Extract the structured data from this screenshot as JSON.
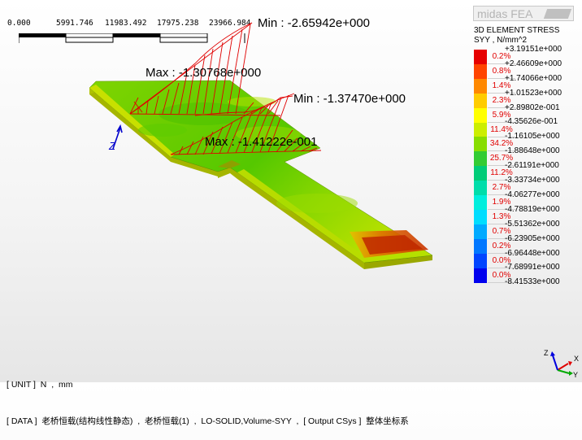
{
  "scale": {
    "labels": [
      "0.000",
      "5991.746",
      "11983.492",
      "17975.238",
      "23966.984"
    ]
  },
  "logo": {
    "text": "midas FEA"
  },
  "legend": {
    "title": "3D ELEMENT STRESS",
    "component": "SYY , N/mm^2",
    "top_value": "+3.19151e+000",
    "rows": [
      {
        "color": "#e60000",
        "pct": "0.2%",
        "value": "+2.46609e+000"
      },
      {
        "color": "#ff4400",
        "pct": "0.8%",
        "value": "+1.74066e+000"
      },
      {
        "color": "#ff8800",
        "pct": "1.4%",
        "value": "+1.01523e+000"
      },
      {
        "color": "#ffcc00",
        "pct": "2.3%",
        "value": "+2.89802e-001"
      },
      {
        "color": "#ffff00",
        "pct": "5.9%",
        "value": "-4.35626e-001"
      },
      {
        "color": "#ccee00",
        "pct": "11.4%",
        "value": "-1.16105e+000"
      },
      {
        "color": "#88dd00",
        "pct": "34.2%",
        "value": "-1.88648e+000"
      },
      {
        "color": "#33cc33",
        "pct": "25.7%",
        "value": "-2.61191e+000"
      },
      {
        "color": "#00cc77",
        "pct": "11.2%",
        "value": "-3.33734e+000"
      },
      {
        "color": "#00ddaa",
        "pct": "2.7%",
        "value": "-4.06277e+000"
      },
      {
        "color": "#00eedd",
        "pct": "1.9%",
        "value": "-4.78819e+000"
      },
      {
        "color": "#00ddff",
        "pct": "1.3%",
        "value": "-5.51362e+000"
      },
      {
        "color": "#00aaff",
        "pct": "0.7%",
        "value": "-6.23905e+000"
      },
      {
        "color": "#0077ff",
        "pct": "0.2%",
        "value": "-6.96448e+000"
      },
      {
        "color": "#0044ff",
        "pct": "0.0%",
        "value": "-7.68991e+000"
      },
      {
        "color": "#0000ee",
        "pct": "0.0%",
        "value": "-8.41533e+000"
      }
    ]
  },
  "annotations": {
    "min1": "Min : -2.65942e+000",
    "max1": "Max : -1.30768e+000",
    "min2": "Min : -1.37470e+000",
    "max2": "Max : -1.41222e-001",
    "axis_label": "Z"
  },
  "info": {
    "unit_line": "[ UNIT ]  N  ,  mm",
    "data_line": "[ DATA ]  老桥恒载(结构线性静态)  ,  老桥恒载(1)  ,  LO-SOLID,Volume-SYY  ,  [ Output CSys ]  整体坐标系"
  },
  "triad": {
    "x": "X",
    "y": "Y",
    "z": "Z"
  }
}
